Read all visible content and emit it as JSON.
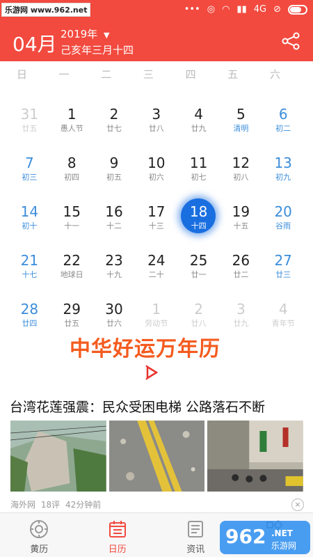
{
  "watermark": "乐游网 www.962.net",
  "status": {
    "network": "4G"
  },
  "header": {
    "month": "04月",
    "year_label": "2019年",
    "lunar_label": "己亥年三月十四"
  },
  "weekdays": [
    "日",
    "一",
    "二",
    "三",
    "四",
    "五",
    "六"
  ],
  "calendar": {
    "rows": [
      [
        {
          "n": "31",
          "l": "廿五",
          "other": true
        },
        {
          "n": "1",
          "l": "愚人节"
        },
        {
          "n": "2",
          "l": "廿七"
        },
        {
          "n": "3",
          "l": "廿八"
        },
        {
          "n": "4",
          "l": "廿九"
        },
        {
          "n": "5",
          "l": "清明",
          "hl": true
        },
        {
          "n": "6",
          "l": "初二"
        }
      ],
      [
        {
          "n": "7",
          "l": "初三"
        },
        {
          "n": "8",
          "l": "初四"
        },
        {
          "n": "9",
          "l": "初五"
        },
        {
          "n": "10",
          "l": "初六"
        },
        {
          "n": "11",
          "l": "初七"
        },
        {
          "n": "12",
          "l": "初八"
        },
        {
          "n": "13",
          "l": "初九"
        }
      ],
      [
        {
          "n": "14",
          "l": "初十"
        },
        {
          "n": "15",
          "l": "十一"
        },
        {
          "n": "16",
          "l": "十二"
        },
        {
          "n": "17",
          "l": "十三"
        },
        {
          "n": "18",
          "l": "十四",
          "selected": true
        },
        {
          "n": "19",
          "l": "十五"
        },
        {
          "n": "20",
          "l": "谷雨"
        }
      ],
      [
        {
          "n": "21",
          "l": "十七"
        },
        {
          "n": "22",
          "l": "地球日"
        },
        {
          "n": "23",
          "l": "十九"
        },
        {
          "n": "24",
          "l": "二十"
        },
        {
          "n": "25",
          "l": "廿一"
        },
        {
          "n": "26",
          "l": "廿二"
        },
        {
          "n": "27",
          "l": "廿三"
        }
      ],
      [
        {
          "n": "28",
          "l": "廿四"
        },
        {
          "n": "29",
          "l": "廿五"
        },
        {
          "n": "30",
          "l": "廿六"
        },
        {
          "n": "1",
          "l": "劳动节",
          "other": true
        },
        {
          "n": "2",
          "l": "廿八",
          "other": true
        },
        {
          "n": "3",
          "l": "廿九",
          "other": true
        },
        {
          "n": "4",
          "l": "青年节",
          "other": true
        }
      ]
    ]
  },
  "banner": {
    "text": "中华好运万年历"
  },
  "news": {
    "title": "台湾花莲强震：民众受困电梯 公路落石不断",
    "source": "海外网",
    "comments": "18评",
    "time": "42分钟前",
    "close": "×"
  },
  "tabs": [
    {
      "label": "黄历"
    },
    {
      "label": "日历",
      "active": true
    },
    {
      "label": "资讯"
    },
    {
      "label": ""
    }
  ],
  "logo": {
    "text": "962",
    "sub": "NET 乐游网"
  },
  "colors": {
    "brand_red": "#f24a3f",
    "weekend_blue": "#3b8ddb",
    "selected_blue": "#1a6fe0"
  }
}
